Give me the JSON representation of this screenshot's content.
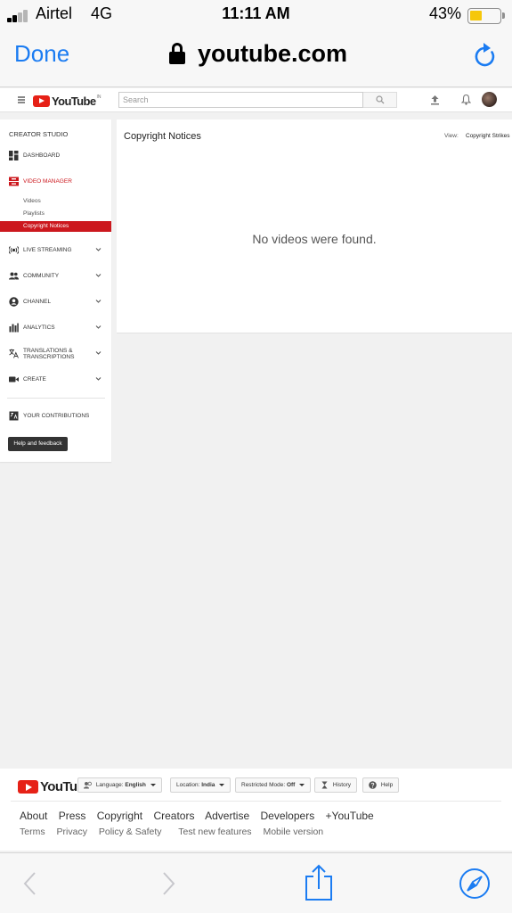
{
  "status_bar": {
    "carrier": "Airtel",
    "network": "4G",
    "time": "11:11 AM",
    "battery_percent": "43%",
    "battery_level": 0.43
  },
  "browser": {
    "done_label": "Done",
    "domain": "youtube.com"
  },
  "masthead": {
    "logo_text": "YouTube",
    "logo_country": "IN",
    "search_placeholder": "Search"
  },
  "sidebar": {
    "title": "CREATOR STUDIO",
    "dashboard": "DASHBOARD",
    "video_manager": "VIDEO MANAGER",
    "sub_items": [
      "Videos",
      "Playlists",
      "Copyright Notices"
    ],
    "live_streaming": "LIVE STREAMING",
    "community": "COMMUNITY",
    "channel": "CHANNEL",
    "analytics": "ANALYTICS",
    "translations_line1": "TRANSLATIONS &",
    "translations_line2": "TRANSCRIPTIONS",
    "create": "CREATE",
    "contributions": "YOUR CONTRIBUTIONS",
    "help_button": "Help and feedback"
  },
  "main": {
    "title": "Copyright Notices",
    "view_label": "View:",
    "view_value": "Copyright Strikes",
    "empty_message": "No videos were found."
  },
  "footer": {
    "logo_text": "YouTube",
    "language_label": "Language:",
    "language_value": "English",
    "location_label": "Location:",
    "location_value": "India",
    "restricted_label": "Restricted Mode:",
    "restricted_value": "Off",
    "history_label": "History",
    "help_label": "Help",
    "links_primary": [
      "About",
      "Press",
      "Copyright",
      "Creators",
      "Advertise",
      "Developers",
      "+YouTube"
    ],
    "links_secondary": [
      "Terms",
      "Privacy",
      "Policy & Safety",
      "Test new features",
      "Mobile version"
    ]
  },
  "colors": {
    "ios_blue": "#1b7cf2",
    "youtube_red": "#e62117",
    "active_red": "#cc181e",
    "battery_yellow": "#f6c70a"
  }
}
